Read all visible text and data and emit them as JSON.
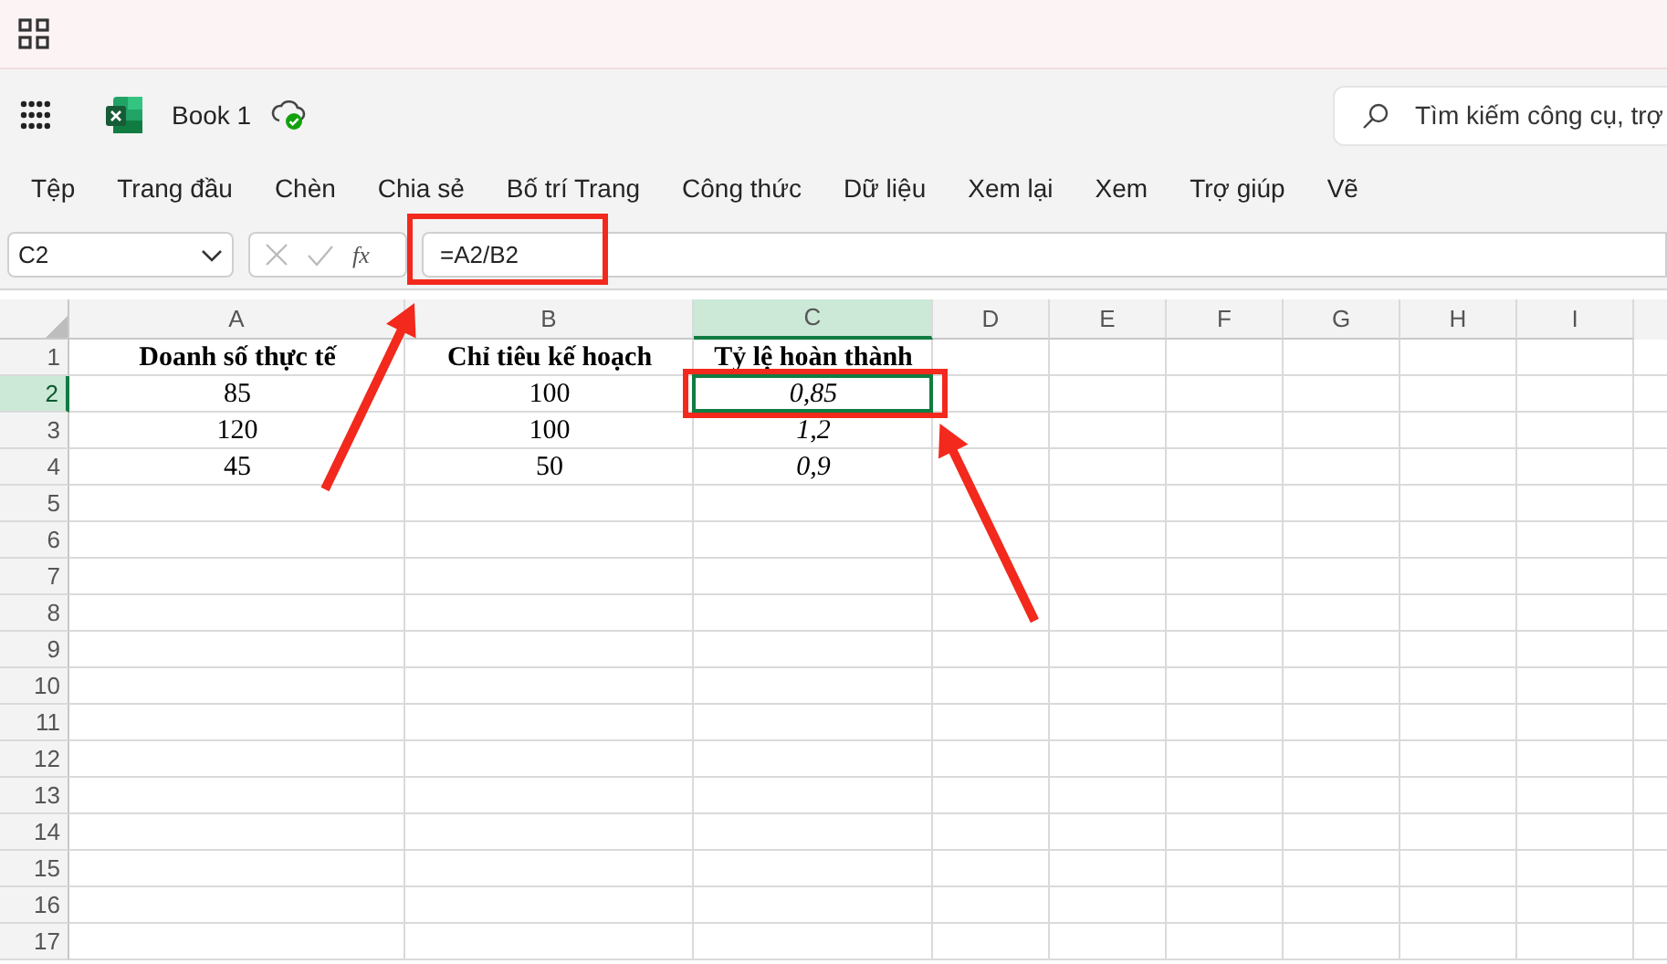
{
  "workbook": {
    "title": "Book 1",
    "saved": true
  },
  "search": {
    "placeholder": "Tìm kiếm công cụ, trợ"
  },
  "tabs": [
    {
      "label": "Tệp"
    },
    {
      "label": "Trang đầu"
    },
    {
      "label": "Chèn"
    },
    {
      "label": "Chia sẻ"
    },
    {
      "label": "Bố trí Trang"
    },
    {
      "label": "Công thức"
    },
    {
      "label": "Dữ liệu"
    },
    {
      "label": "Xem lại"
    },
    {
      "label": "Xem"
    },
    {
      "label": "Trợ giúp"
    },
    {
      "label": "Vẽ"
    }
  ],
  "name_box": {
    "value": "C2"
  },
  "formula_bar": {
    "fx": "fx",
    "value": "=A2/B2"
  },
  "columns": [
    {
      "label": "A",
      "italic": false,
      "selected": false
    },
    {
      "label": "B",
      "italic": false,
      "selected": false
    },
    {
      "label": "C",
      "italic": true,
      "selected": true
    },
    {
      "label": "D",
      "selected": false
    },
    {
      "label": "E",
      "selected": false
    },
    {
      "label": "F",
      "selected": false
    },
    {
      "label": "G",
      "selected": false
    },
    {
      "label": "H",
      "selected": false
    },
    {
      "label": "I",
      "selected": false
    }
  ],
  "rows": [
    {
      "label": "1",
      "kind": "header",
      "selected": false,
      "cells": [
        {
          "value": "Doanh số thực tế",
          "selected": false
        },
        {
          "value": "Chỉ tiêu kế hoạch",
          "selected": false
        },
        {
          "value": "Tỷ lệ hoàn thành",
          "selected": false
        }
      ]
    },
    {
      "label": "2",
      "kind": "data",
      "selected": true,
      "cells": [
        {
          "value": "85",
          "selected": false
        },
        {
          "value": "100",
          "selected": false
        },
        {
          "value": "0,85",
          "selected": true
        }
      ]
    },
    {
      "label": "3",
      "kind": "data",
      "selected": false,
      "cells": [
        {
          "value": "120",
          "selected": false
        },
        {
          "value": "100",
          "selected": false
        },
        {
          "value": "1,2",
          "selected": false
        }
      ]
    },
    {
      "label": "4",
      "kind": "data",
      "selected": false,
      "cells": [
        {
          "value": "45",
          "selected": false
        },
        {
          "value": "50",
          "selected": false
        },
        {
          "value": "0,9",
          "selected": false
        }
      ]
    },
    {
      "label": "5",
      "selected": false,
      "cells": []
    },
    {
      "label": "6",
      "selected": false,
      "cells": []
    },
    {
      "label": "7",
      "selected": false,
      "cells": []
    },
    {
      "label": "8",
      "selected": false,
      "cells": []
    },
    {
      "label": "9",
      "selected": false,
      "cells": []
    },
    {
      "label": "10",
      "selected": false,
      "cells": []
    },
    {
      "label": "11",
      "selected": false,
      "cells": []
    },
    {
      "label": "12",
      "selected": false,
      "cells": []
    },
    {
      "label": "13",
      "selected": false,
      "cells": []
    },
    {
      "label": "14",
      "selected": false,
      "cells": []
    },
    {
      "label": "15",
      "selected": false,
      "cells": []
    },
    {
      "label": "16",
      "selected": false,
      "cells": []
    },
    {
      "label": "17",
      "selected": false,
      "cells": []
    }
  ]
}
